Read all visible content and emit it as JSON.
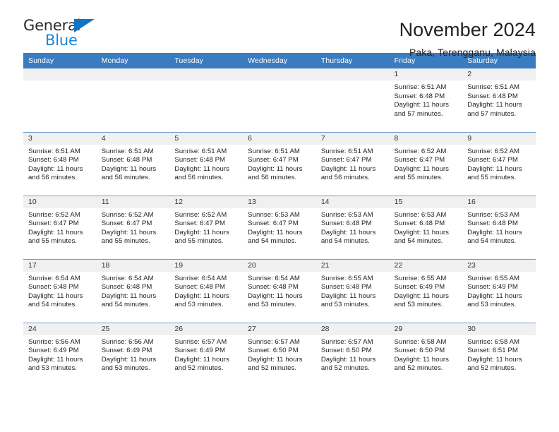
{
  "brand": {
    "name_top": "General",
    "name_bottom": "Blue",
    "accent_color": "#1c86d4"
  },
  "header": {
    "title": "November 2024",
    "subtitle": "Paka, Terengganu, Malaysia"
  },
  "calendar": {
    "header_bg": "#3a7cc0",
    "daynum_bg": "#f0f0f0",
    "weekdays": [
      "Sunday",
      "Monday",
      "Tuesday",
      "Wednesday",
      "Thursday",
      "Friday",
      "Saturday"
    ],
    "weeks": [
      [
        {
          "day": "",
          "empty": true
        },
        {
          "day": "",
          "empty": true
        },
        {
          "day": "",
          "empty": true
        },
        {
          "day": "",
          "empty": true
        },
        {
          "day": "",
          "empty": true
        },
        {
          "day": "1",
          "sunrise": "Sunrise: 6:51 AM",
          "sunset": "Sunset: 6:48 PM",
          "daylight": "Daylight: 11 hours and 57 minutes."
        },
        {
          "day": "2",
          "sunrise": "Sunrise: 6:51 AM",
          "sunset": "Sunset: 6:48 PM",
          "daylight": "Daylight: 11 hours and 57 minutes."
        }
      ],
      [
        {
          "day": "3",
          "sunrise": "Sunrise: 6:51 AM",
          "sunset": "Sunset: 6:48 PM",
          "daylight": "Daylight: 11 hours and 56 minutes."
        },
        {
          "day": "4",
          "sunrise": "Sunrise: 6:51 AM",
          "sunset": "Sunset: 6:48 PM",
          "daylight": "Daylight: 11 hours and 56 minutes."
        },
        {
          "day": "5",
          "sunrise": "Sunrise: 6:51 AM",
          "sunset": "Sunset: 6:48 PM",
          "daylight": "Daylight: 11 hours and 56 minutes."
        },
        {
          "day": "6",
          "sunrise": "Sunrise: 6:51 AM",
          "sunset": "Sunset: 6:47 PM",
          "daylight": "Daylight: 11 hours and 56 minutes."
        },
        {
          "day": "7",
          "sunrise": "Sunrise: 6:51 AM",
          "sunset": "Sunset: 6:47 PM",
          "daylight": "Daylight: 11 hours and 56 minutes."
        },
        {
          "day": "8",
          "sunrise": "Sunrise: 6:52 AM",
          "sunset": "Sunset: 6:47 PM",
          "daylight": "Daylight: 11 hours and 55 minutes."
        },
        {
          "day": "9",
          "sunrise": "Sunrise: 6:52 AM",
          "sunset": "Sunset: 6:47 PM",
          "daylight": "Daylight: 11 hours and 55 minutes."
        }
      ],
      [
        {
          "day": "10",
          "sunrise": "Sunrise: 6:52 AM",
          "sunset": "Sunset: 6:47 PM",
          "daylight": "Daylight: 11 hours and 55 minutes."
        },
        {
          "day": "11",
          "sunrise": "Sunrise: 6:52 AM",
          "sunset": "Sunset: 6:47 PM",
          "daylight": "Daylight: 11 hours and 55 minutes."
        },
        {
          "day": "12",
          "sunrise": "Sunrise: 6:52 AM",
          "sunset": "Sunset: 6:47 PM",
          "daylight": "Daylight: 11 hours and 55 minutes."
        },
        {
          "day": "13",
          "sunrise": "Sunrise: 6:53 AM",
          "sunset": "Sunset: 6:47 PM",
          "daylight": "Daylight: 11 hours and 54 minutes."
        },
        {
          "day": "14",
          "sunrise": "Sunrise: 6:53 AM",
          "sunset": "Sunset: 6:48 PM",
          "daylight": "Daylight: 11 hours and 54 minutes."
        },
        {
          "day": "15",
          "sunrise": "Sunrise: 6:53 AM",
          "sunset": "Sunset: 6:48 PM",
          "daylight": "Daylight: 11 hours and 54 minutes."
        },
        {
          "day": "16",
          "sunrise": "Sunrise: 6:53 AM",
          "sunset": "Sunset: 6:48 PM",
          "daylight": "Daylight: 11 hours and 54 minutes."
        }
      ],
      [
        {
          "day": "17",
          "sunrise": "Sunrise: 6:54 AM",
          "sunset": "Sunset: 6:48 PM",
          "daylight": "Daylight: 11 hours and 54 minutes."
        },
        {
          "day": "18",
          "sunrise": "Sunrise: 6:54 AM",
          "sunset": "Sunset: 6:48 PM",
          "daylight": "Daylight: 11 hours and 54 minutes."
        },
        {
          "day": "19",
          "sunrise": "Sunrise: 6:54 AM",
          "sunset": "Sunset: 6:48 PM",
          "daylight": "Daylight: 11 hours and 53 minutes."
        },
        {
          "day": "20",
          "sunrise": "Sunrise: 6:54 AM",
          "sunset": "Sunset: 6:48 PM",
          "daylight": "Daylight: 11 hours and 53 minutes."
        },
        {
          "day": "21",
          "sunrise": "Sunrise: 6:55 AM",
          "sunset": "Sunset: 6:48 PM",
          "daylight": "Daylight: 11 hours and 53 minutes."
        },
        {
          "day": "22",
          "sunrise": "Sunrise: 6:55 AM",
          "sunset": "Sunset: 6:49 PM",
          "daylight": "Daylight: 11 hours and 53 minutes."
        },
        {
          "day": "23",
          "sunrise": "Sunrise: 6:55 AM",
          "sunset": "Sunset: 6:49 PM",
          "daylight": "Daylight: 11 hours and 53 minutes."
        }
      ],
      [
        {
          "day": "24",
          "sunrise": "Sunrise: 6:56 AM",
          "sunset": "Sunset: 6:49 PM",
          "daylight": "Daylight: 11 hours and 53 minutes."
        },
        {
          "day": "25",
          "sunrise": "Sunrise: 6:56 AM",
          "sunset": "Sunset: 6:49 PM",
          "daylight": "Daylight: 11 hours and 53 minutes."
        },
        {
          "day": "26",
          "sunrise": "Sunrise: 6:57 AM",
          "sunset": "Sunset: 6:49 PM",
          "daylight": "Daylight: 11 hours and 52 minutes."
        },
        {
          "day": "27",
          "sunrise": "Sunrise: 6:57 AM",
          "sunset": "Sunset: 6:50 PM",
          "daylight": "Daylight: 11 hours and 52 minutes."
        },
        {
          "day": "28",
          "sunrise": "Sunrise: 6:57 AM",
          "sunset": "Sunset: 6:50 PM",
          "daylight": "Daylight: 11 hours and 52 minutes."
        },
        {
          "day": "29",
          "sunrise": "Sunrise: 6:58 AM",
          "sunset": "Sunset: 6:50 PM",
          "daylight": "Daylight: 11 hours and 52 minutes."
        },
        {
          "day": "30",
          "sunrise": "Sunrise: 6:58 AM",
          "sunset": "Sunset: 6:51 PM",
          "daylight": "Daylight: 11 hours and 52 minutes."
        }
      ]
    ]
  }
}
